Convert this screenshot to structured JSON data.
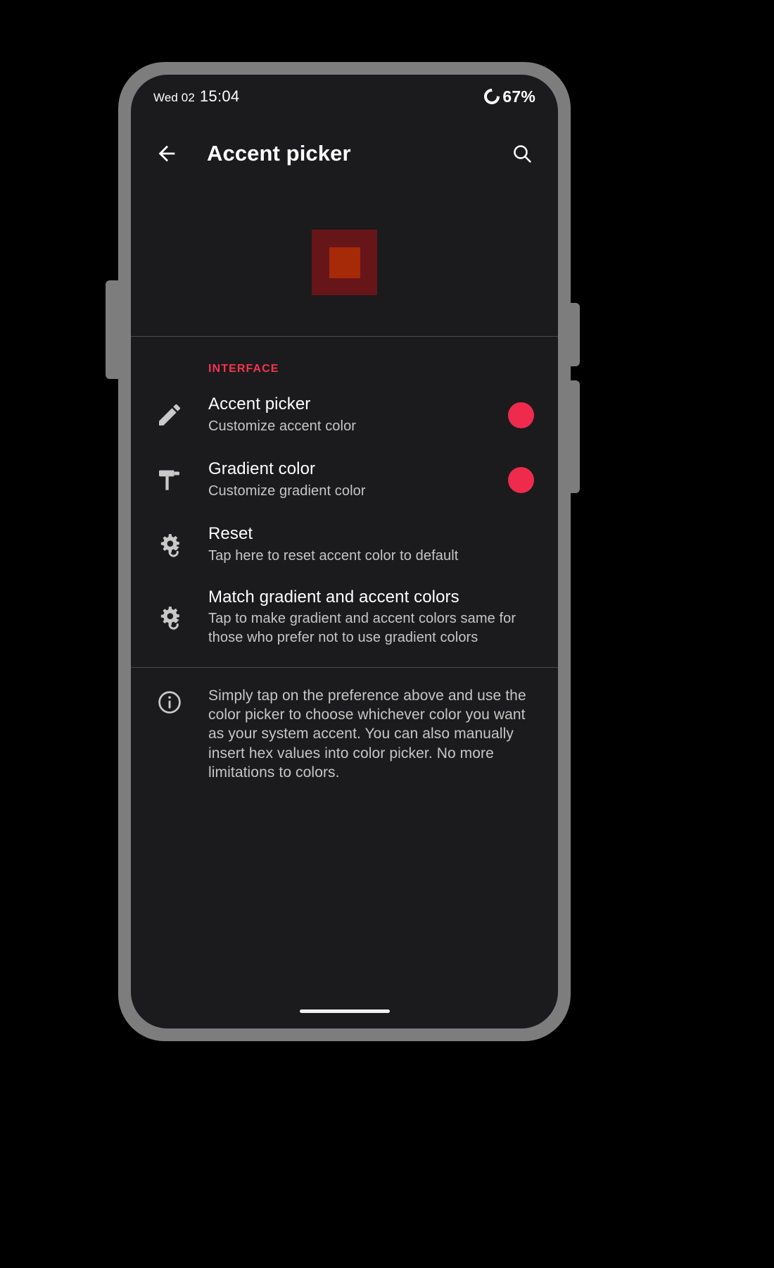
{
  "status_bar": {
    "day": "Wed 02",
    "time": "15:04",
    "battery_percent": "67%",
    "battery_icon": "battery-ring-icon"
  },
  "app_bar": {
    "back_icon": "arrow-left-icon",
    "title": "Accent picker",
    "search_icon": "search-icon"
  },
  "preview": {
    "outer_color": "#661519",
    "inner_color": "#a62908"
  },
  "section": {
    "header": "INTERFACE",
    "header_color": "#f2354e"
  },
  "preferences": [
    {
      "icon": "pencil-icon",
      "title": "Accent picker",
      "summary": "Customize accent color",
      "swatch_color": "#ef2b4d"
    },
    {
      "icon": "paint-roller-icon",
      "title": "Gradient color",
      "summary": "Customize gradient color",
      "swatch_color": "#ef2b4d"
    },
    {
      "icon": "gear-refresh-icon",
      "title": "Reset",
      "summary": "Tap here to reset accent color to default",
      "swatch_color": null
    },
    {
      "icon": "gear-refresh-icon",
      "title": "Match gradient and accent colors",
      "summary": "Tap to make gradient and accent colors same for those who prefer not to use gradient colors",
      "swatch_color": null
    }
  ],
  "footer": {
    "icon": "info-icon",
    "text": "Simply tap on the preference above and use the color picker to choose whichever color you want as your system accent. You can also manually insert hex values into color picker. No more limitations to colors."
  },
  "nav": {
    "gesture_bar": "home-gesture-bar"
  }
}
